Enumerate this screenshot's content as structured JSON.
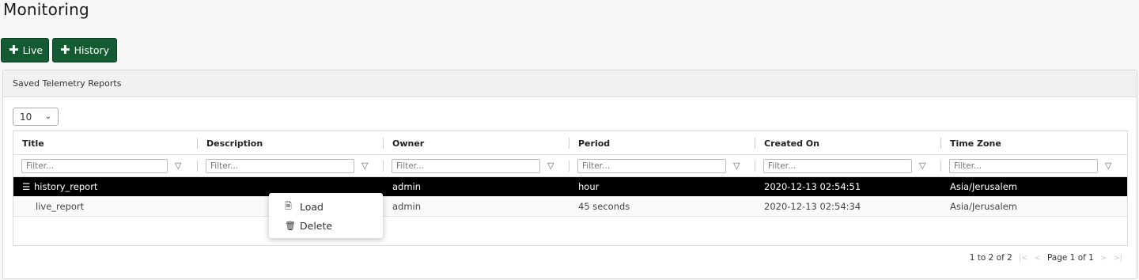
{
  "page": {
    "title": "Monitoring"
  },
  "buttons": {
    "live": "Live",
    "history": "History"
  },
  "panel": {
    "title": "Saved Telemetry Reports"
  },
  "page_size": {
    "value": "10"
  },
  "columns": [
    "Title",
    "Description",
    "Owner",
    "Period",
    "Created On",
    "Time Zone"
  ],
  "filter_placeholder": "Filter...",
  "rows": [
    {
      "title": "history_report",
      "description": "",
      "owner": "admin",
      "period": "hour",
      "created_on": "2020-12-13 02:54:51",
      "time_zone": "Asia/Jerusalem",
      "selected": true
    },
    {
      "title": "live_report",
      "description": "",
      "owner": "admin",
      "period": "45 seconds",
      "created_on": "2020-12-13 02:54:34",
      "time_zone": "Asia/Jerusalem",
      "selected": false
    }
  ],
  "pager": {
    "range": "1 to 2 of 2",
    "page": "Page 1 of 1"
  },
  "context_menu": {
    "load": "Load",
    "delete": "Delete"
  },
  "colors": {
    "button_bg": "#145a32",
    "selected_row_bg": "#000000"
  }
}
